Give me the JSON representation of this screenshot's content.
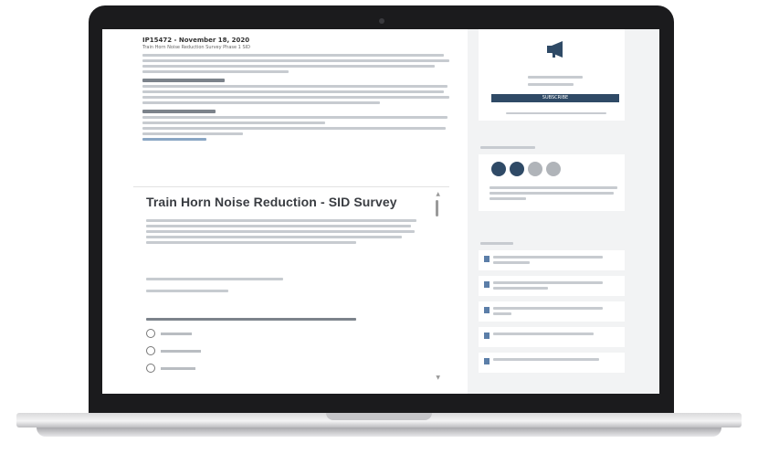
{
  "page": {
    "heading": "IP15472 - November 18, 2020",
    "subheading": "Train Horn Noise Reduction Survey Phase 1 SID"
  },
  "survey": {
    "title": "Train Horn Noise Reduction - SID Survey"
  },
  "sidebar": {
    "button_label": "SUBSCRIBE"
  },
  "icons": [
    "megaphone-icon",
    "doc-icon",
    "radio-icon",
    "scroll-arrow-icon"
  ],
  "colors": {
    "accent": "#2f4a66",
    "screen_bg": "#f2f3f4",
    "badge_blue": "#2f4a66",
    "badge_grey": "#b0b4b9"
  }
}
